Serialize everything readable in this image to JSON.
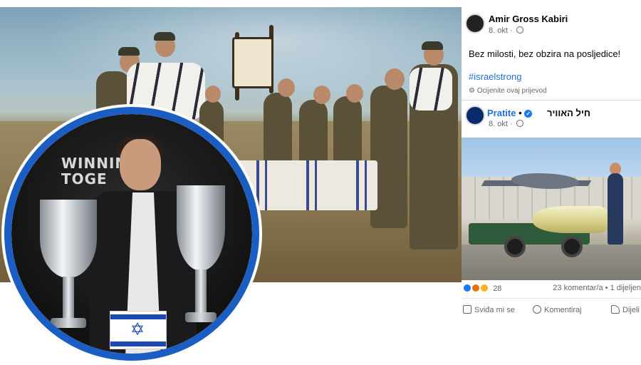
{
  "collage": {
    "profile_banner_text_line1": "WINNIN",
    "profile_banner_text_line2": "TOGE",
    "flag_star": "✡"
  },
  "post1": {
    "author": "Amir Gross Kabiri",
    "date": "8. okt",
    "text": "Bez milosti, bez obzira na posljedice!",
    "hashtag": "#israelstrong",
    "translate_label": "Ocijenite ovaj prijevod"
  },
  "post2": {
    "follow_label": "Pratite",
    "separator": "•",
    "page_name": "חיל האוויר",
    "date": "8. okt",
    "reaction_count": "28",
    "comments_shares": "23 komentar/a • 1 dijeljen",
    "like_label": "Sviđa mi se",
    "comment_label": "Komentiraj",
    "share_label": "Dijeli"
  },
  "colors": {
    "facebook_blue": "#216fdb",
    "profile_ring": "#1a5ec4",
    "flag_blue": "#1a49b3"
  },
  "icons": [
    "globe-icon",
    "settings-icon",
    "verified-icon",
    "like-icon",
    "comment-icon",
    "share-icon"
  ]
}
